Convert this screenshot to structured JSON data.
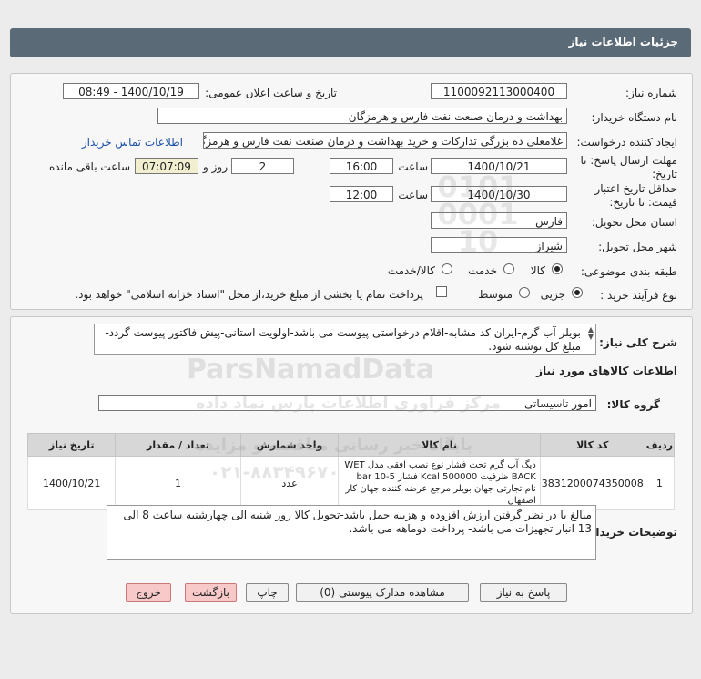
{
  "title": "جزئيات اطلاعات نياز",
  "labels": {
    "need_number": "شماره نياز:",
    "announce_datetime": "تاريخ و ساعت اعلان عمومی:",
    "buyer_org": "نام دستگاه خريدار:",
    "requester": "ايجاد کننده درخواست:",
    "reply_deadline_1": "مهلت ارسال پاسخ: تا",
    "reply_deadline_2": "تاريخ:",
    "price_valid_1": "حداقل تاريخ اعتبار",
    "price_valid_2": "قيمت: تا تاريخ:",
    "province": "استان محل تحويل:",
    "city": "شهر محل تحويل:",
    "category": "طبقه بندی موضوعی:",
    "process": "نوع فرآيند خريد :",
    "time": "ساعت",
    "days_and": "روز و",
    "remaining": "ساعت باقی مانده"
  },
  "values": {
    "need_number": "1100092113000400",
    "announce_datetime": "1400/10/19 - 08:49",
    "buyer_org": "بهداشت و درمان صنعت نفت فارس و هرمزگان",
    "requester": "غلامعلی ده بزرگی تدارکات و خريد بهداشت و درمان صنعت نفت فارس و هرمزگان",
    "reply_date": "1400/10/21",
    "reply_time": "16:00",
    "reply_days": "2",
    "reply_remaining": "07:07:09",
    "valid_date": "1400/10/30",
    "valid_time": "12:00",
    "province": "فارس",
    "city": "شيراز"
  },
  "contact_link": "اطلاعات تماس خريدار",
  "category_options": [
    "کالا",
    "خدمت",
    "کالا/خدمت"
  ],
  "category_selected": 0,
  "process_options": [
    "جزيی",
    "متوسط"
  ],
  "process_selected": 0,
  "payment_note": "پرداخت تمام يا بخشی از مبلغ خريد،از محل \"اسناد خزانه اسلامی\" خواهد بود.",
  "general_desc_label": "شرح کلی نياز:",
  "general_desc": "بويلر آب گرم-ايران کد مشابه-اقلام درخواستی پيوست می باشد-اولويت استانی-پيش فاکتور پيوست گردد-مبلغ کل نوشته شود.",
  "goods_info_title": "اطلاعات کالاهای مورد نياز",
  "goods_group_label": "گروه کالا:",
  "goods_group": "امور تاسيساتی",
  "table": {
    "headers": [
      "رديف",
      "کد کالا",
      "نام کالا",
      "واحد شمارش",
      "تعداد / مقدار",
      "تاريخ نياز"
    ],
    "rows": [
      [
        "1",
        "3831200074350008",
        "ديگ آب گرم تحت فشار نوع نصب افقی مدل WET BACK ظرفيت 500000 Kcal فشار 5-10 bar نام تجارتی جهان بويلر مرجع عرضه کننده جهان کار اصفهان",
        "عدد",
        "1",
        "1400/10/21"
      ]
    ]
  },
  "buyer_notes_label": "توضيحات خريدار:",
  "buyer_notes": "مبالغ با در نظر گرفتن ارزش افزوده و هزينه حمل باشد-تحويل کالا روز شنبه الی چهارشنبه ساعت 8 الی 13 انبار تجهيزات می باشد- پرداخت دوماهه می باشد.",
  "buttons": {
    "reply": "پاسخ به نياز",
    "view_docs": "مشاهده مدارک پيوستی (0)",
    "print": "چاپ",
    "back": "بازگشت",
    "exit": "خروج"
  },
  "watermark": {
    "brand": "ParsNamadData",
    "line1": "مرکز فراوری اطلاعات پارس نماد داده",
    "line2": "پایگاه خبر رسانی مناقصه و مزایده",
    "phone": "۰۲۱-۸۸۳۴۹۶۷۰",
    "stamp_number": "0101 0001 10"
  }
}
